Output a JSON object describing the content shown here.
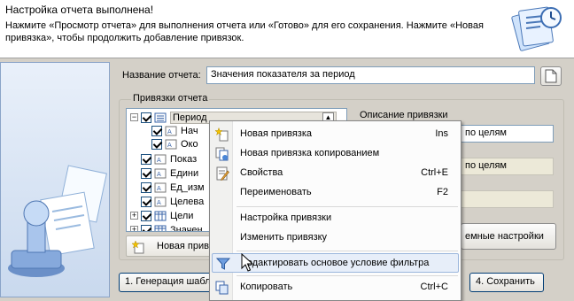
{
  "header": {
    "title": "Настройка отчета выполнена!",
    "description": "Нажмите «Просмотр отчета» для выполнения отчета или «Готово» для его сохранения. Нажмите «Новая привязка», чтобы продолжить добавление привязок."
  },
  "report": {
    "name_label": "Название отчета:",
    "name_value": "Значения показателя за период"
  },
  "bindings": {
    "group_title": "Привязки отчета",
    "tree": [
      {
        "label": "Период",
        "level": 0,
        "expander": "−"
      },
      {
        "label": "Нач",
        "level": 1,
        "expander": ""
      },
      {
        "label": "Око",
        "level": 1,
        "expander": ""
      },
      {
        "label": "Показ",
        "level": 0,
        "expander": ""
      },
      {
        "label": "Едини",
        "level": 0,
        "expander": ""
      },
      {
        "label": "Ед_изм",
        "level": 0,
        "expander": ""
      },
      {
        "label": "Целева",
        "level": 0,
        "expander": ""
      },
      {
        "label": "Цели",
        "level": 0,
        "expander": "+"
      },
      {
        "label": "Значен",
        "level": 0,
        "expander": "+"
      }
    ],
    "new_binding_button": "Новая прив",
    "description_label": "Описание привязки",
    "right_fields": [
      "по целям",
      "по целям",
      "",
      ""
    ],
    "extra_settings_button": "емные настройки"
  },
  "context_menu": {
    "items": [
      {
        "label": "Новая привязка",
        "shortcut": "Ins",
        "icon": "new-binding-icon"
      },
      {
        "label": "Новая привязка копированием",
        "shortcut": "",
        "icon": "copy-binding-icon"
      },
      {
        "label": "Свойства",
        "shortcut": "Ctrl+E",
        "icon": "properties-icon"
      },
      {
        "label": "Переименовать",
        "shortcut": "F2",
        "icon": ""
      },
      {
        "label": "Настройка привязки",
        "shortcut": "",
        "icon": ""
      },
      {
        "label": "Изменить привязку",
        "shortcut": "",
        "icon": ""
      },
      {
        "label": "Редактировать основое условие фильтра",
        "shortcut": "",
        "icon": "filter-icon"
      },
      {
        "label": "Копировать",
        "shortcut": "Ctrl+C",
        "icon": "copy-icon"
      }
    ]
  },
  "footer": {
    "generate_button": "1. Генерация шабл",
    "save_button": "4. Сохранить"
  },
  "colors": {
    "accent": "#316ac5",
    "menu_highlight": "#e7eef9",
    "panel_bg": "#d4d0c8"
  }
}
